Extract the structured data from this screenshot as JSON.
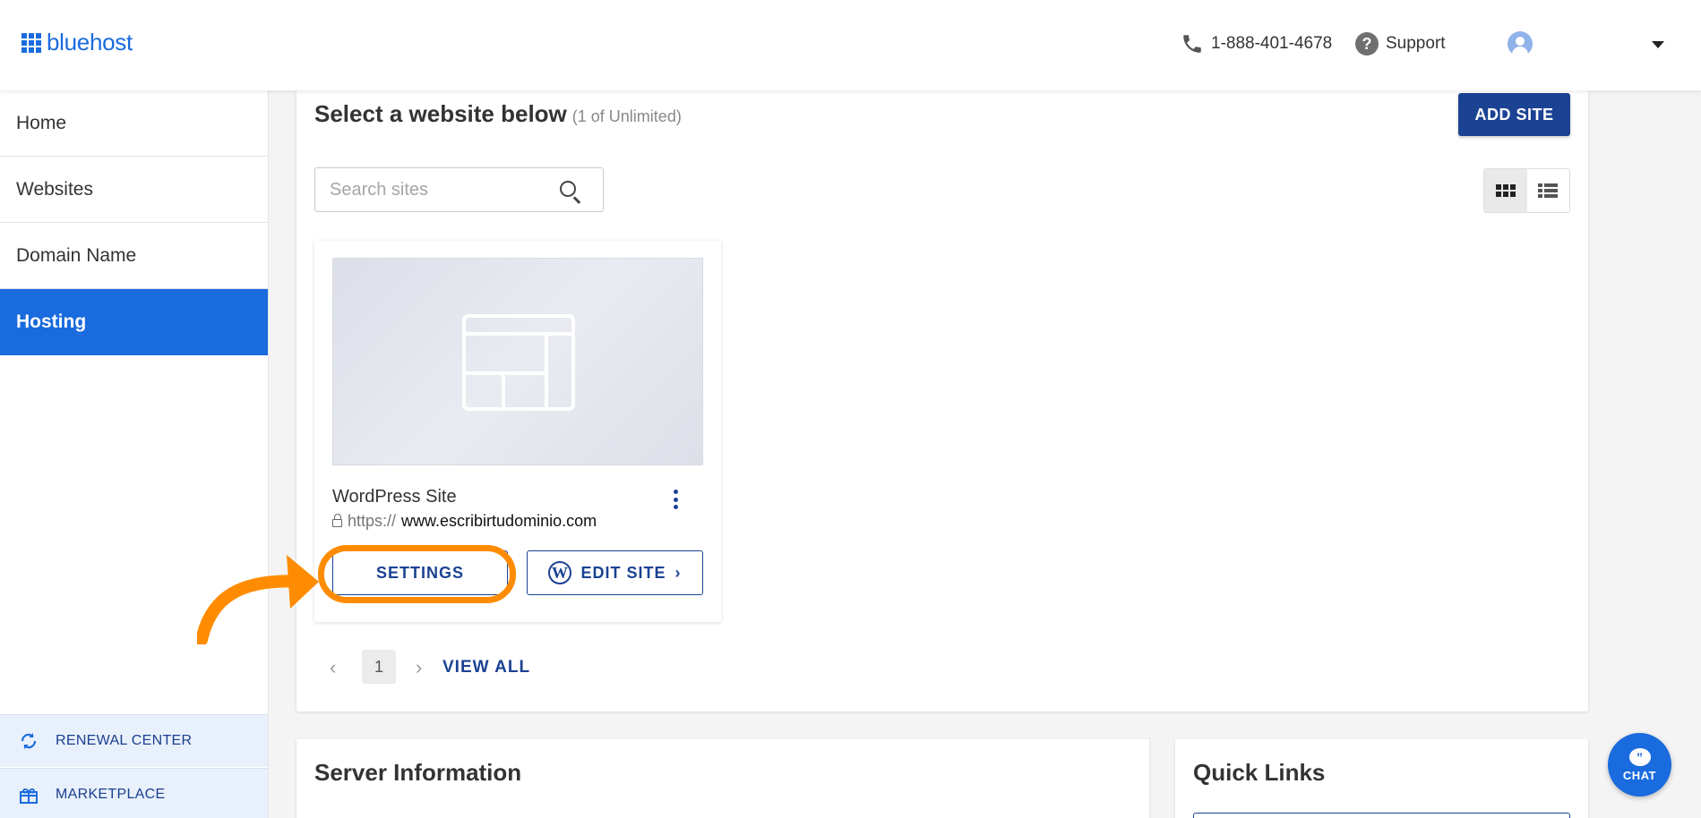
{
  "header": {
    "logo_text": "bluehost",
    "phone": "1-888-401-4678",
    "support_label": "Support"
  },
  "sidebar": {
    "items": [
      {
        "label": "Home",
        "active": false
      },
      {
        "label": "Websites",
        "active": false
      },
      {
        "label": "Domain Name",
        "active": false
      },
      {
        "label": "Hosting",
        "active": true
      }
    ],
    "renewal_label": "RENEWAL CENTER",
    "marketplace_label": "MARKETPLACE"
  },
  "main": {
    "title": "Select a website below",
    "count": "(1 of Unlimited)",
    "add_site_label": "ADD SITE",
    "search_placeholder": "Search sites",
    "view_modes": [
      "grid",
      "list"
    ],
    "selected_view": "grid"
  },
  "site_card": {
    "name": "WordPress Site",
    "url_protocol": "https://",
    "url_host": "www.escribirtudominio.com",
    "settings_label": "SETTINGS",
    "edit_label": "EDIT SITE"
  },
  "pagination": {
    "current_page": "1",
    "view_all_label": "VIEW ALL"
  },
  "lower": {
    "server_title": "Server Information",
    "quick_links_title": "Quick Links"
  },
  "chat": {
    "label": "CHAT"
  },
  "colors": {
    "brand_blue": "#196bde",
    "navy": "#1b4293",
    "highlight_orange": "#ff8c00"
  }
}
